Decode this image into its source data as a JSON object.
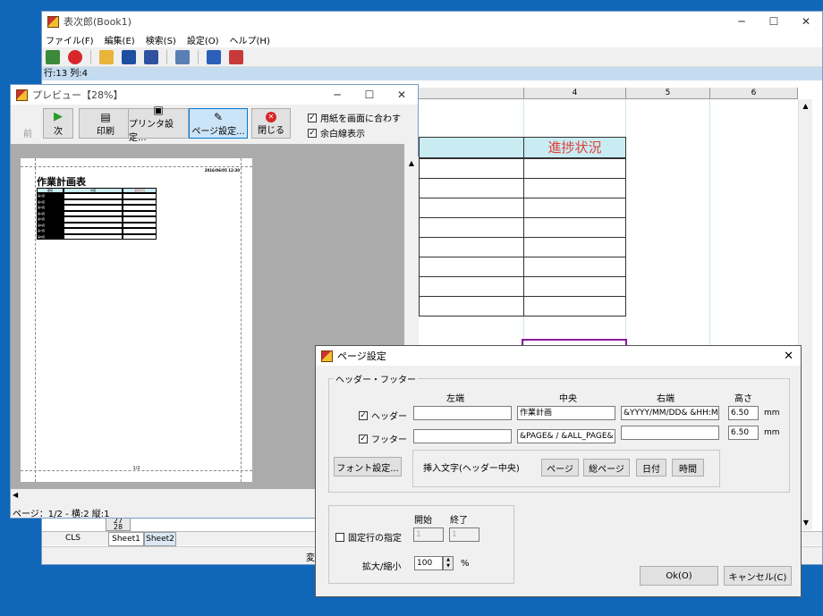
{
  "main": {
    "title": "表次郎(Book1)",
    "menu": [
      "ファイル(F)",
      "編集(E)",
      "検索(S)",
      "設定(O)",
      "ヘルプ(H)"
    ],
    "status": "行:13  列:4",
    "columns": [
      "4",
      "5",
      "6"
    ],
    "progress_header": "進捗状況",
    "row_labels": [
      "27",
      "28"
    ],
    "bottom": {
      "cls": "CLS",
      "sheet1": "Sheet1",
      "sheet2": "Sheet2",
      "status_fragment": "変"
    }
  },
  "preview": {
    "title": "プレビュー【28%】",
    "buttons": {
      "prev": "前",
      "next": "次",
      "print": "印刷",
      "printer": "プリンタ設定...",
      "page": "ページ設定...",
      "close": "閉じる"
    },
    "options": {
      "fit": "用紙を画面に合わす",
      "margin": "余白線表示"
    },
    "page": {
      "heading": "作業計画表",
      "header_right": "2016/06/05 12:30",
      "col_headers": [
        "期間",
        "内容",
        "進捗状況"
      ],
      "rows": [
        "第1週",
        "第2週",
        "第3週",
        "第4週",
        "第5週",
        "第6週",
        "第7週",
        "第8週"
      ],
      "footer": "1/2"
    },
    "status": "ページ：1/2 - 横:2 縦:1"
  },
  "dialog": {
    "title": "ページ設定",
    "group": "ヘッダー・フッター",
    "cols": {
      "left": "左端",
      "center": "中央",
      "right": "右端",
      "height": "高さ"
    },
    "header": {
      "label": "ヘッダー",
      "left": "",
      "center": "作業計画",
      "right": "&YYYY/MM/DD& &HH:MM&",
      "height": "6.50",
      "unit": "mm"
    },
    "footer": {
      "label": "フッター",
      "left": "",
      "center": "&PAGE& / &ALL_PAGE&",
      "right": "",
      "height": "6.50",
      "unit": "mm"
    },
    "font_button": "フォント設定...",
    "insert_label": "挿入文字(ヘッダー中央)",
    "insert_buttons": [
      "ページ",
      "総ページ",
      "日付",
      "時間"
    ],
    "fixed_rows": {
      "label": "固定行の指定",
      "start_label": "開始",
      "end_label": "終了",
      "start": "1",
      "end": "1"
    },
    "zoom": {
      "label": "拡大/縮小",
      "value": "100",
      "unit": "%"
    },
    "ok": "Ok(O)",
    "cancel": "キャンセル(C)"
  },
  "colors": {
    "desktop": "#1066b8",
    "header_fill": "#c9ecf2",
    "progress_red": "#e0413a",
    "selection": "#8b1a9b"
  }
}
